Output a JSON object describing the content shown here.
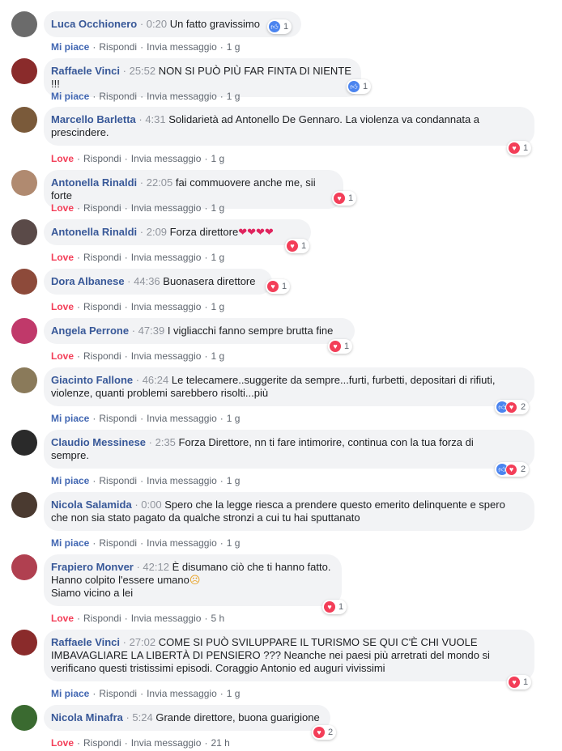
{
  "labels": {
    "like": "Mi piace",
    "love": "Love",
    "reply": "Rispondi",
    "message": "Invia messaggio",
    "sep": "·"
  },
  "colors": {
    "author": "#385898",
    "like": "#4267b2",
    "love": "#f33e58",
    "bubble": "#f2f3f5"
  },
  "comments": [
    {
      "author": "Luca Occhionero",
      "timestamp": "0:20",
      "text_lines": [
        "Un fatto gravissimo"
      ],
      "action": "Mi piace",
      "age": "1 g",
      "reactions": [
        "like-icon"
      ],
      "count": "1"
    },
    {
      "author": "Raffaele Vinci",
      "timestamp": "25:52",
      "text_lines": [
        "NON SI PUÒ PIÙ FAR FINTA DI NIENTE !!!"
      ],
      "action": "Mi piace",
      "age": "1 g",
      "reactions": [
        "like-icon"
      ],
      "count": "1"
    },
    {
      "author": "Marcello Barletta",
      "timestamp": "4:31",
      "text_lines": [
        "Solidarietà ad Antonello De Gennaro. La violenza va condannata a",
        "prescindere."
      ],
      "action": "Love",
      "age": "1 g",
      "reactions": [
        "love-icon"
      ],
      "count": "1"
    },
    {
      "author": "Antonella Rinaldi",
      "timestamp": "22:05",
      "text_lines": [
        "fai commuovere anche me, sii forte"
      ],
      "action": "Love",
      "age": "1 g",
      "reactions": [
        "love-icon"
      ],
      "count": "1"
    },
    {
      "author": "Antonella Rinaldi",
      "timestamp": "2:09",
      "text_lines": [
        "Forza direttore"
      ],
      "action": "Love",
      "age": "1 g",
      "reactions": [
        "love-icon"
      ],
      "count": "1"
    },
    {
      "author": "Dora Albanese",
      "timestamp": "44:36",
      "text_lines": [
        "Buonasera direttore"
      ],
      "action": "Love",
      "age": "1 g",
      "reactions": [
        "love-icon"
      ],
      "count": "1"
    },
    {
      "author": "Angela Perrone",
      "timestamp": "47:39",
      "text_lines": [
        "I vigliacchi fanno sempre brutta fine"
      ],
      "action": "Love",
      "age": "1 g",
      "reactions": [
        "love-icon"
      ],
      "count": "1"
    },
    {
      "author": "Giacinto Fallone",
      "timestamp": "46:24",
      "text_lines": [
        "Le telecamere..suggerite da sempre...furti, furbetti, depositari di rifiuti,",
        "violenze, quanti problemi sarebbero risolti...più"
      ],
      "action": "Mi piace",
      "age": "1 g",
      "reactions": [
        "like-icon",
        "love-icon"
      ],
      "count": "2"
    },
    {
      "author": "Claudio Messinese",
      "timestamp": "2:35",
      "text_lines": [
        "Forza Direttore, nn ti fare intimorire, continua con la tua forza di",
        "sempre."
      ],
      "action": "Mi piace",
      "age": "1 g",
      "reactions": [
        "like-icon",
        "love-icon"
      ],
      "count": "2"
    },
    {
      "author": "Nicola Salamida",
      "timestamp": "0:00",
      "text_lines": [
        "Spero che la legge riesca a prendere questo emerito delinquente e spero",
        "che non sia stato pagato da qualche stronzi a cui tu hai sputtanato"
      ],
      "action": "Mi piace",
      "age": "1 g",
      "reactions": [],
      "count": ""
    },
    {
      "author": "Frapiero Monver",
      "timestamp": "42:12",
      "text_lines": [
        "È disumano ciò che ti hanno fatto.",
        "Hanno colpito l'essere umano",
        "Siamo vicino a lei"
      ],
      "action": "Love",
      "age": "5 h",
      "reactions": [
        "love-icon"
      ],
      "count": "1"
    },
    {
      "author": "Raffaele Vinci",
      "timestamp": "27:02",
      "text_lines": [
        "COME SI PUÒ SVILUPPARE IL TURISMO SE QUI C'È CHI VUOLE",
        "IMBAVAGLIARE LA LIBERTÀ DI PENSIERO ??? Neanche nei paesi più arretrati del mondo si",
        "verificano questi tristissimi episodi. Coraggio Antonio ed auguri vivissimi"
      ],
      "action": "Mi piace",
      "age": "1 g",
      "reactions": [
        "love-icon"
      ],
      "count": "1"
    },
    {
      "author": "Nicola Minafra",
      "timestamp": "5:24",
      "text_lines": [
        "Grande direttore, buona guarigione"
      ],
      "action": "Love",
      "age": "21 h",
      "reactions": [
        "love-icon"
      ],
      "count": "2"
    }
  ]
}
